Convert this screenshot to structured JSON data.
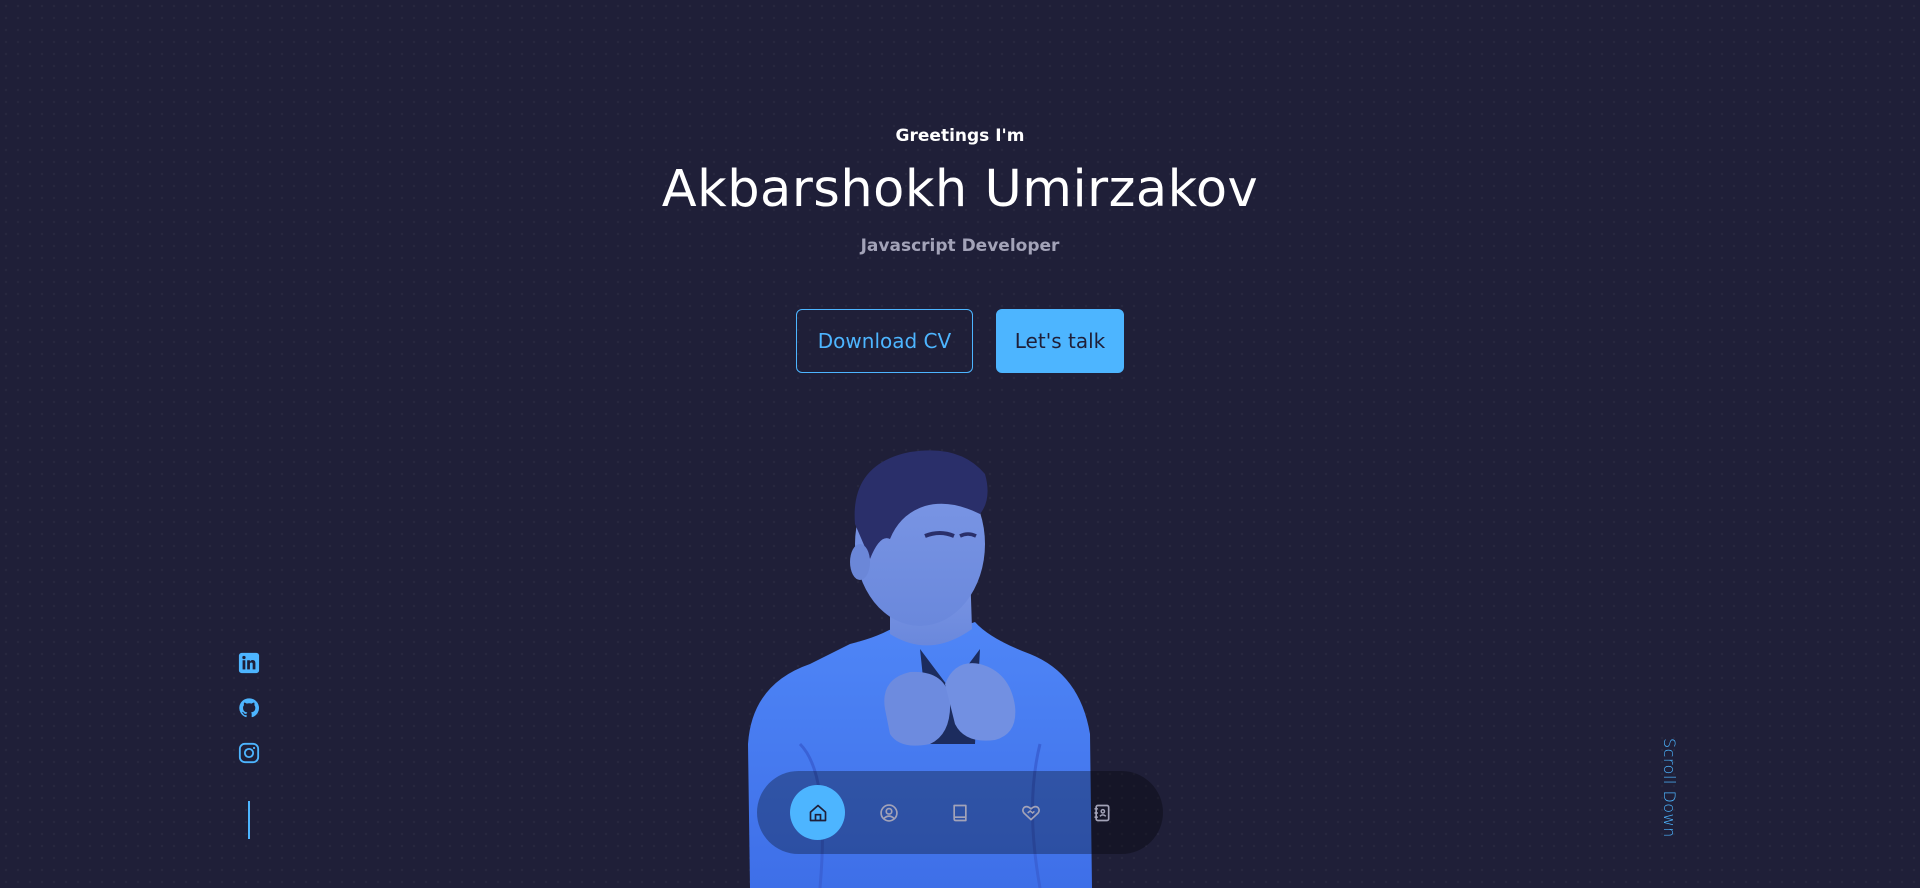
{
  "header": {
    "greeting": "Greetings I'm",
    "name": "Akbarshokh Umirzakov",
    "role": "Javascript Developer"
  },
  "cta": {
    "download_label": "Download CV",
    "talk_label": "Let's talk"
  },
  "socials": [
    {
      "name": "linkedin",
      "icon": "linkedin-icon"
    },
    {
      "name": "github",
      "icon": "github-icon"
    },
    {
      "name": "instagram",
      "icon": "instagram-icon"
    }
  ],
  "scroll": {
    "label": "Scroll Down"
  },
  "nav": [
    {
      "id": "home",
      "icon": "home-icon",
      "active": true
    },
    {
      "id": "about",
      "icon": "user-icon",
      "active": false
    },
    {
      "id": "experience",
      "icon": "book-icon",
      "active": false
    },
    {
      "id": "services",
      "icon": "handshake-icon",
      "active": false
    },
    {
      "id": "contact",
      "icon": "contacts-icon",
      "active": false
    }
  ],
  "colors": {
    "background": "#1f1f38",
    "accent": "#4db5ff",
    "text": "#ffffff",
    "muted": "#a3a3b8"
  }
}
